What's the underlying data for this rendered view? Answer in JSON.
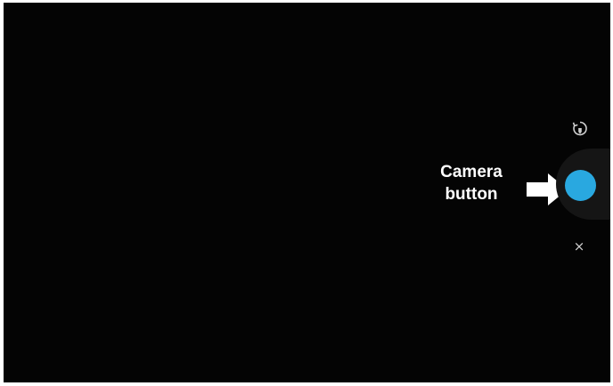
{
  "callout": {
    "line1": "Camera",
    "line2": "button"
  },
  "controls": {
    "switch_icon": "camera-switch-icon",
    "capture_icon": "shutter-icon",
    "close_icon": "close-icon",
    "close_glyph": "×"
  },
  "colors": {
    "background": "#040404",
    "capture": "#29a8e0",
    "ring": "#151515",
    "icon": "#cfcfcf"
  }
}
